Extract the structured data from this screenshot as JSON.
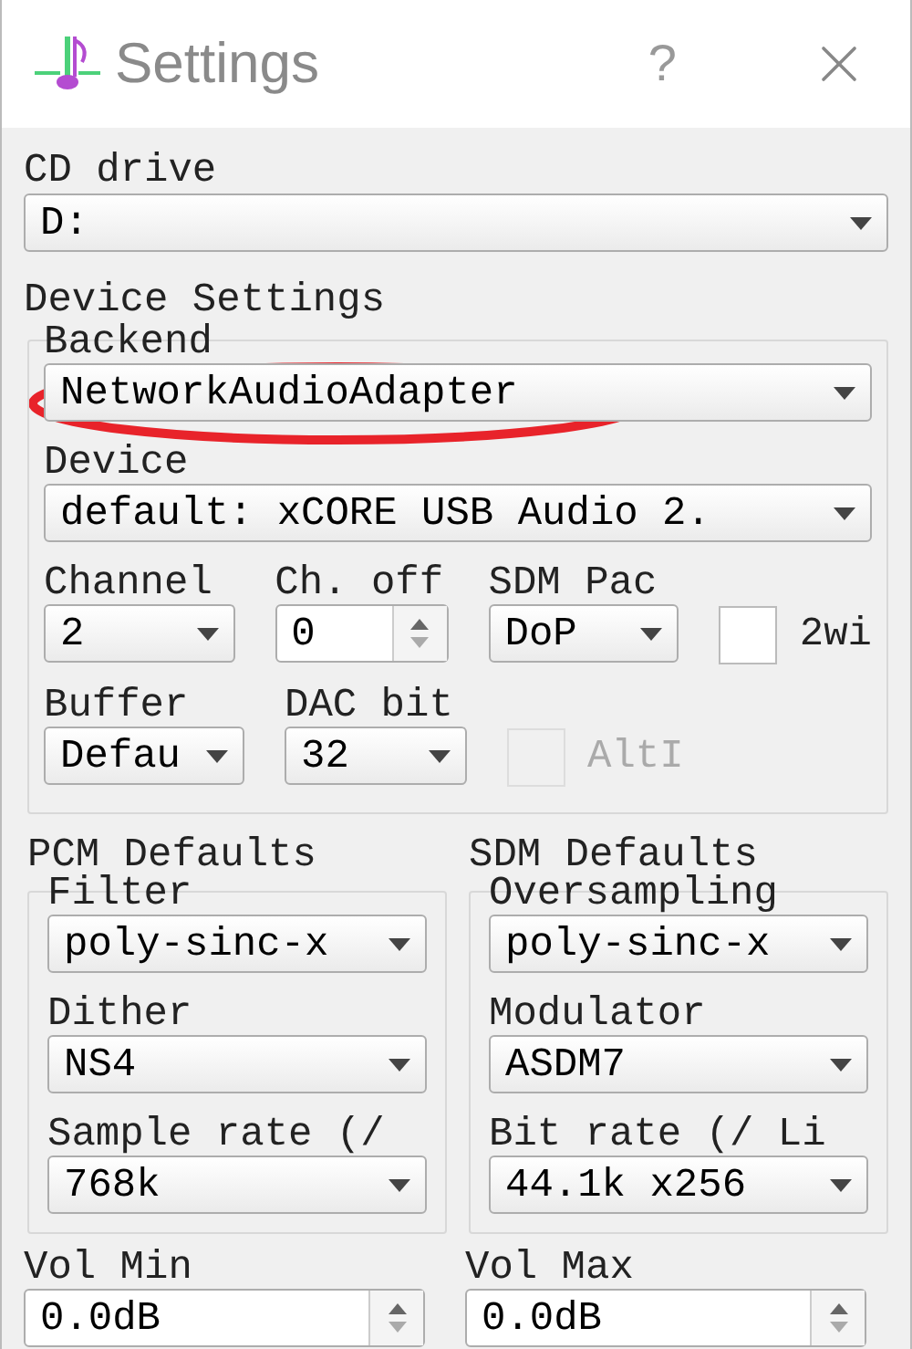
{
  "window": {
    "title": "Settings",
    "help": "?"
  },
  "cd_drive": {
    "label": "CD drive",
    "value": "D:"
  },
  "device_settings": {
    "title": "Device Settings",
    "backend": {
      "label": "Backend",
      "value": "NetworkAudioAdapter"
    },
    "device": {
      "label": "Device",
      "value": "default: xCORE USB Audio 2."
    },
    "rows": [
      [
        {
          "kind": "combo",
          "label": "Channel",
          "value": "2"
        },
        {
          "kind": "spin",
          "label": "Ch. off",
          "value": "0"
        },
        {
          "kind": "combo",
          "label": "SDM Pac",
          "value": "DoP"
        },
        {
          "kind": "checkbox",
          "label": "2wi",
          "checked": false,
          "disabled": false
        }
      ],
      [
        {
          "kind": "combo",
          "label": "Buffer",
          "value": "Defau"
        },
        {
          "kind": "combo",
          "label": "DAC bit",
          "value": "32"
        },
        {
          "kind": "checkbox",
          "label": "AltI",
          "checked": false,
          "disabled": true
        }
      ]
    ]
  },
  "pcm_defaults": {
    "title": "PCM Defaults",
    "fields": [
      {
        "label": "Filter",
        "value": "poly-sinc-x"
      },
      {
        "label": "Dither",
        "value": "NS4"
      },
      {
        "label": "Sample rate (/",
        "value": "768k"
      }
    ]
  },
  "sdm_defaults": {
    "title": "SDM Defaults",
    "fields": [
      {
        "label": "Oversampling",
        "value": "poly-sinc-x"
      },
      {
        "label": "Modulator",
        "value": "ASDM7"
      },
      {
        "label": "Bit rate (/ Li",
        "value": "44.1k x256"
      }
    ]
  },
  "vol_min": {
    "label": "Vol Min",
    "value": "0.0dB"
  },
  "vol_max": {
    "label": "Vol Max",
    "value": "0.0dB"
  }
}
